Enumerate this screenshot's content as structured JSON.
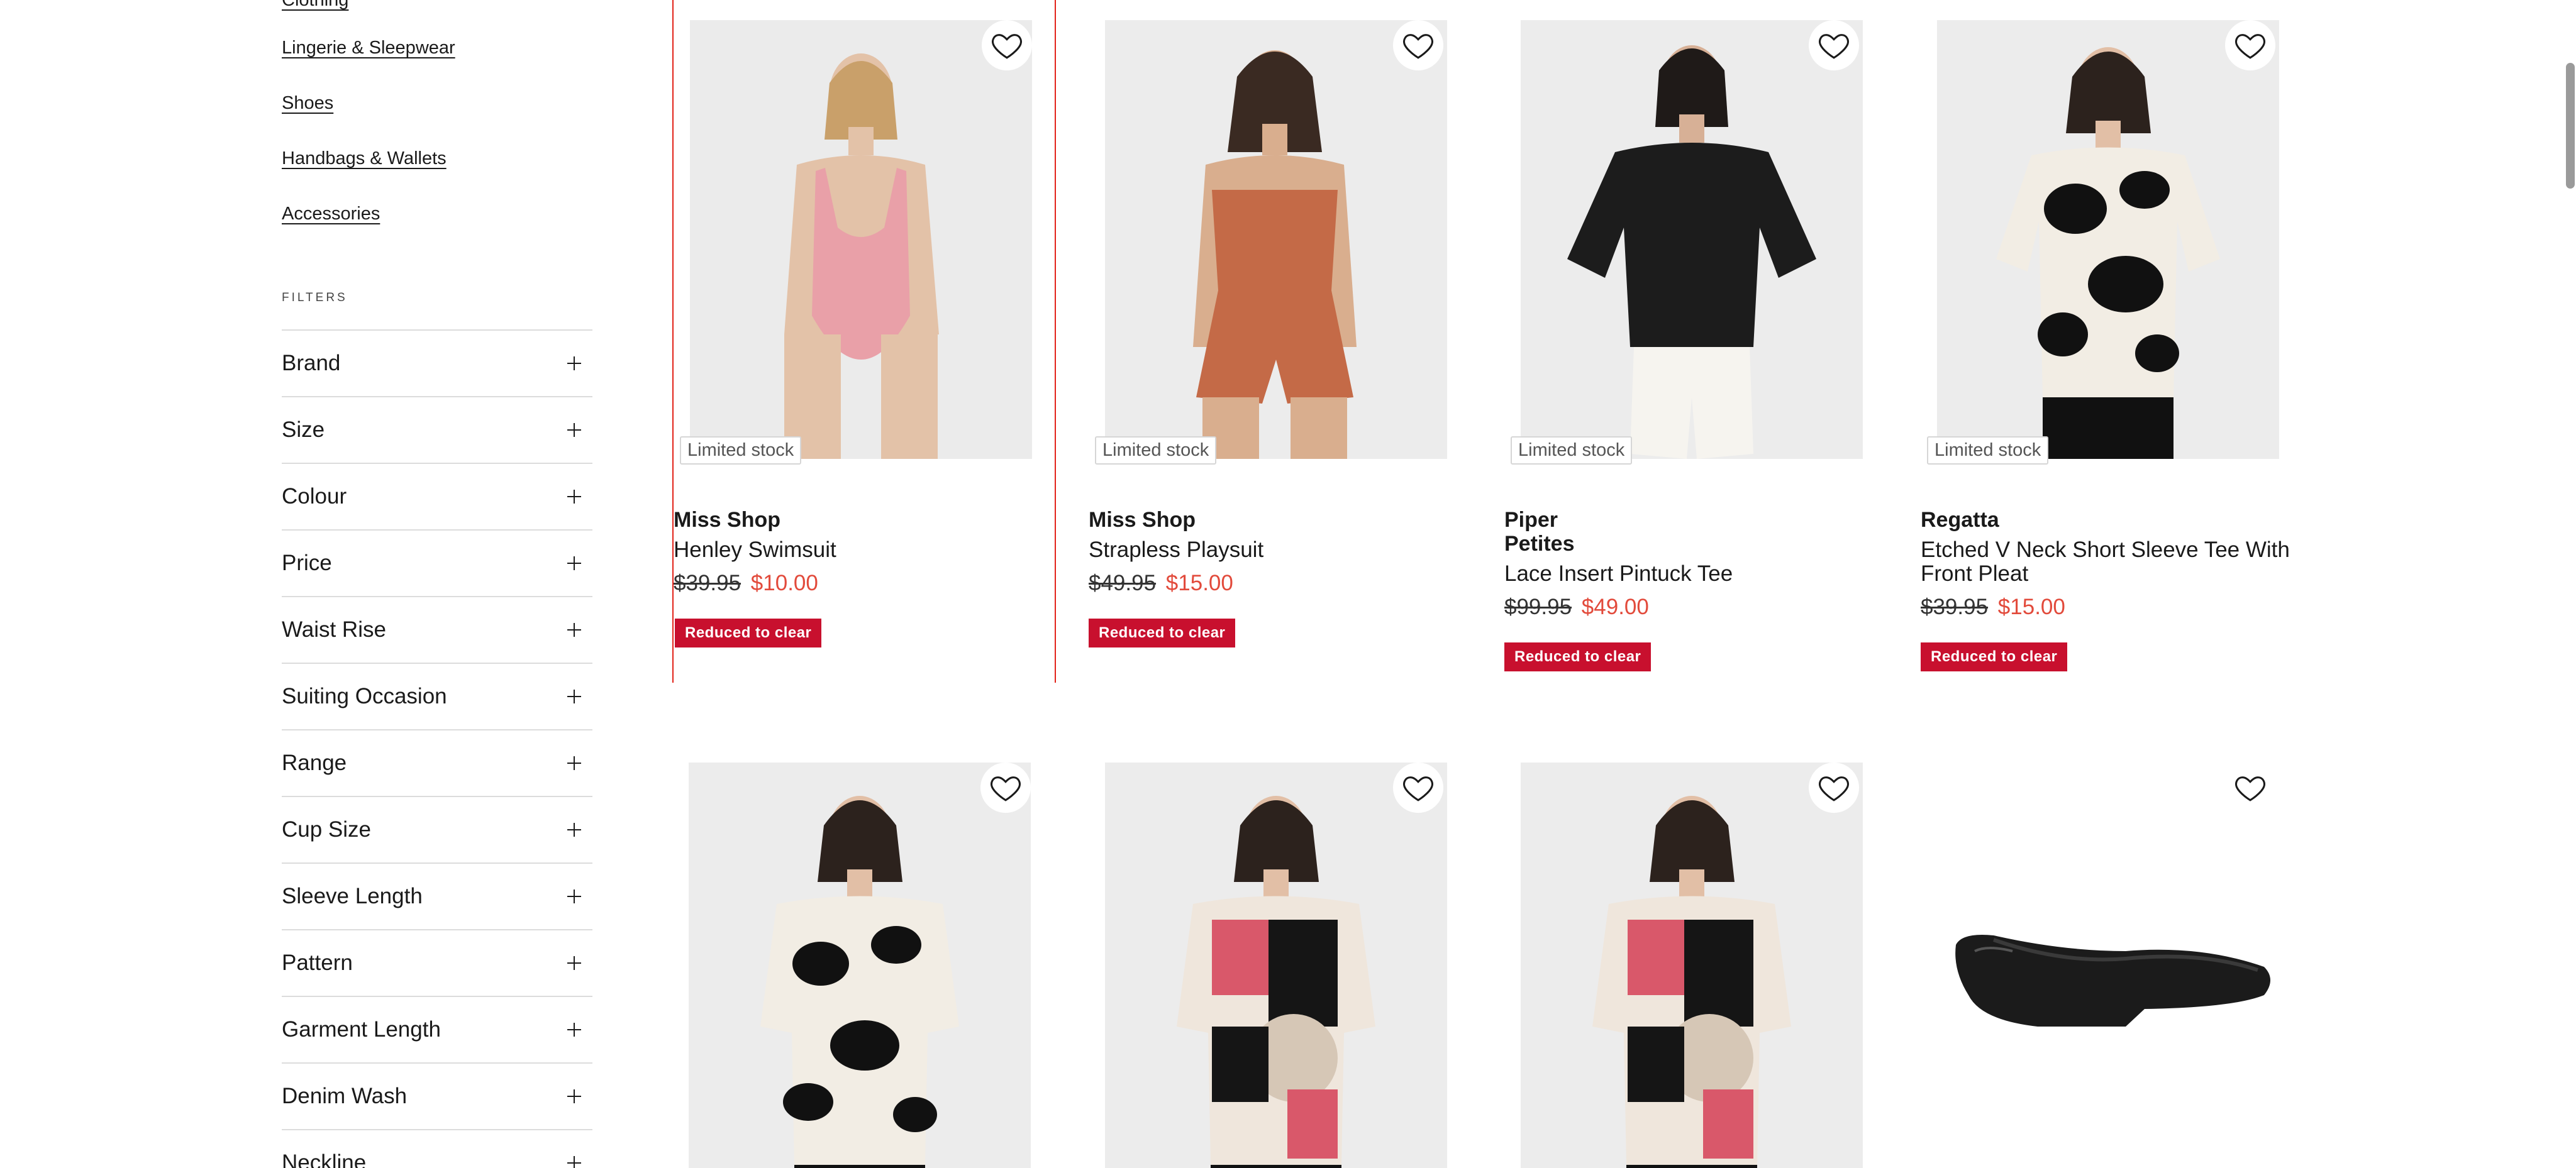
{
  "categories": [
    {
      "label": "Clothing"
    },
    {
      "label": "Lingerie & Sleepwear"
    },
    {
      "label": "Shoes"
    },
    {
      "label": "Handbags & Wallets"
    },
    {
      "label": "Accessories"
    }
  ],
  "filters_heading": "FILTERS",
  "filters": [
    {
      "label": "Brand"
    },
    {
      "label": "Size"
    },
    {
      "label": "Colour"
    },
    {
      "label": "Price"
    },
    {
      "label": "Waist Rise"
    },
    {
      "label": "Suiting Occasion"
    },
    {
      "label": "Range"
    },
    {
      "label": "Cup Size"
    },
    {
      "label": "Sleeve Length"
    },
    {
      "label": "Pattern"
    },
    {
      "label": "Garment Length"
    },
    {
      "label": "Denim Wash"
    },
    {
      "label": "Neckline"
    }
  ],
  "products": [
    {
      "brand": "Miss Shop",
      "name": "Henley Swimsuit",
      "old_price": "$39.95",
      "new_price": "$10.00",
      "stock": "Limited stock",
      "tag": "Reduced to clear"
    },
    {
      "brand": "Miss Shop",
      "name": "Strapless Playsuit",
      "old_price": "$49.95",
      "new_price": "$15.00",
      "stock": "Limited stock",
      "tag": "Reduced to clear"
    },
    {
      "brand": "Piper Petites",
      "name": "Lace Insert Pintuck Tee",
      "old_price": "$99.95",
      "new_price": "$49.00",
      "stock": "Limited stock",
      "tag": "Reduced to clear"
    },
    {
      "brand": "Regatta",
      "name": "Etched V Neck Short Sleeve Tee With Front Pleat",
      "old_price": "$39.95",
      "new_price": "$15.00",
      "stock": "Limited stock",
      "tag": "Reduced to clear"
    },
    {
      "brand": "",
      "name": "",
      "old_price": "",
      "new_price": "",
      "stock": "",
      "tag": ""
    },
    {
      "brand": "",
      "name": "",
      "old_price": "",
      "new_price": "",
      "stock": "",
      "tag": ""
    },
    {
      "brand": "",
      "name": "",
      "old_price": "",
      "new_price": "",
      "stock": "",
      "tag": ""
    },
    {
      "brand": "",
      "name": "",
      "old_price": "",
      "new_price": "",
      "stock": "",
      "tag": ""
    }
  ],
  "colors": {
    "accent_red": "#c8102e",
    "sale_price": "#e24a3b",
    "selection_outline": "#e2231a"
  }
}
